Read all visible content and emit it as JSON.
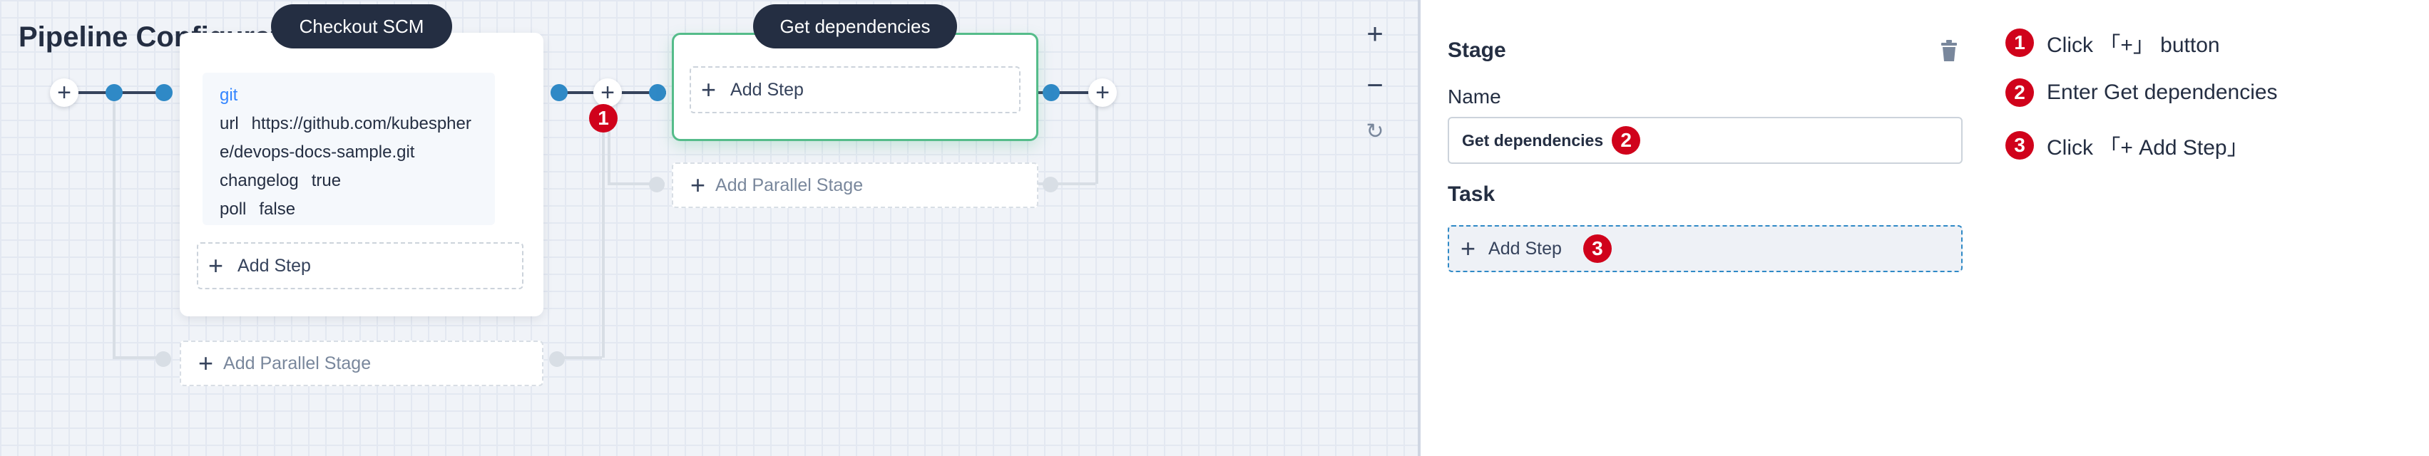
{
  "canvas": {
    "title": "Pipeline Configuration",
    "zoom_in": "+",
    "zoom_out": "−",
    "reset": "↻"
  },
  "stages": [
    {
      "name": "Checkout SCM",
      "task": {
        "type": "git",
        "params": [
          {
            "key": "url",
            "value": "https://github.com/kubespher"
          },
          {
            "key": "",
            "value": "e/devops-docs-sample.git"
          },
          {
            "key": "changelog",
            "value": "true"
          },
          {
            "key": "poll",
            "value": "false"
          }
        ]
      },
      "add_step": "Add Step",
      "add_parallel": "Add Parallel Stage"
    },
    {
      "name": "Get dependencies",
      "add_step": "Add Step",
      "add_parallel": "Add Parallel Stage"
    }
  ],
  "panel": {
    "stage_heading": "Stage",
    "name_label": "Name",
    "name_value": "Get dependencies",
    "task_heading": "Task",
    "task_add_step": "Add Step"
  },
  "markers": [
    "1",
    "2",
    "3"
  ],
  "instructions": [
    {
      "num": "1",
      "text": "Click 「+」 button"
    },
    {
      "num": "2",
      "text": "Enter Get dependencies"
    },
    {
      "num": "3",
      "text": "Click 「+ Add Step」"
    }
  ],
  "colors": {
    "accent": "#2f89c6",
    "active_border": "#55bc8a",
    "pill_bg": "#242e42",
    "marker": "#d0021b"
  }
}
